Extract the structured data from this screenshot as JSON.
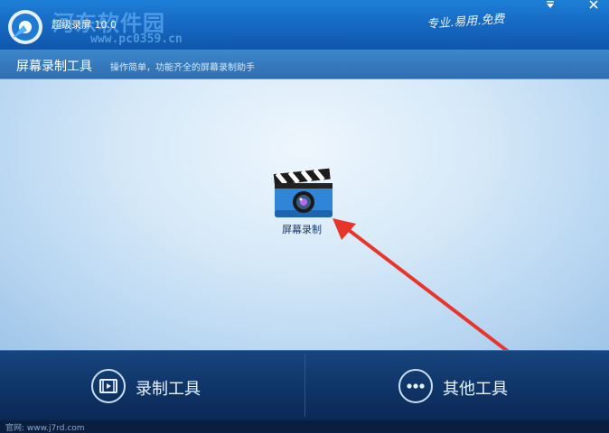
{
  "window": {
    "title": "超级录屏 10.0",
    "slogan": "专业.易用.免费",
    "menu_icon": "menu-down-icon",
    "close_icon": "close-icon"
  },
  "watermark": {
    "text": "河东软件园",
    "url": "www.pc0359.cn"
  },
  "header": {
    "title": "屏幕录制工具",
    "description": "操作简单，功能齐全的屏幕录制助手"
  },
  "main": {
    "tools": [
      {
        "label": "屏幕录制",
        "icon": "clapperboard-camera-icon"
      }
    ],
    "annotation": {
      "type": "arrow",
      "color": "#e8352c"
    }
  },
  "bottom_tabs": [
    {
      "label": "录制工具",
      "icon": "film-icon"
    },
    {
      "label": "其他工具",
      "icon": "more-dots-icon"
    }
  ],
  "status": {
    "text": "官网: www.j7rd.com"
  },
  "colors": {
    "titlebar": "#1566bf",
    "bottombar": "#0f3467",
    "arrow": "#e8352c"
  }
}
